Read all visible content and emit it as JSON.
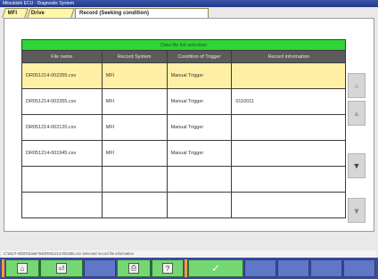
{
  "window": {
    "title": "Mitsubishi ECU - Diagnostic System"
  },
  "tabs": [
    {
      "label": "MFI"
    },
    {
      "label": "Drive Recorder"
    },
    {
      "label": "Record (Seeking condition)"
    }
  ],
  "table": {
    "title": "Data file list selection",
    "columns": [
      "File name",
      "Record System",
      "Condition of Trigger",
      "Record information"
    ],
    "rows": [
      {
        "file": "DR051214-002355.csv",
        "system": "MFI",
        "trigger": "Manual Trigger",
        "info": "",
        "selected": true
      },
      {
        "file": "DR051214-002355.csv",
        "system": "MFI",
        "trigger": "Manual Trigger",
        "info": "0110011",
        "selected": false
      },
      {
        "file": "DR051214-002120.csv",
        "system": "MFI",
        "trigger": "Manual Trigger",
        "info": "",
        "selected": false
      },
      {
        "file": "DR051214-001945.csv",
        "system": "MFI",
        "trigger": "Manual Trigger",
        "info": "",
        "selected": false
      },
      {
        "file": "",
        "system": "",
        "trigger": "",
        "info": "",
        "selected": false
      },
      {
        "file": "",
        "system": "",
        "trigger": "",
        "info": "",
        "selected": false
      }
    ]
  },
  "scroll": {
    "buttons": [
      {
        "name": "scroll-top",
        "glyph": "⩓",
        "enabled": false
      },
      {
        "name": "scroll-page-up",
        "glyph": "▲",
        "enabled": false
      },
      {
        "name": "scroll-down",
        "glyph": "▼",
        "enabled": true
      },
      {
        "name": "scroll-bottom",
        "glyph": "⩔",
        "enabled": true
      }
    ]
  },
  "status": {
    "text": "C:\\MUT-III\\DR\\DataFile\\DR051214-002355.csv  Selected record file information"
  },
  "toolbar": {
    "buttons": [
      {
        "name": "home",
        "icon": "home-icon",
        "glyph": "⌂"
      },
      {
        "name": "back",
        "icon": "back-icon",
        "glyph": "⏎"
      },
      {
        "name": "print",
        "icon": "print-icon",
        "glyph": "⎙"
      },
      {
        "name": "help",
        "icon": "help-icon",
        "glyph": "?"
      },
      {
        "name": "ok",
        "icon": "check-icon",
        "glyph": "✓"
      }
    ]
  }
}
